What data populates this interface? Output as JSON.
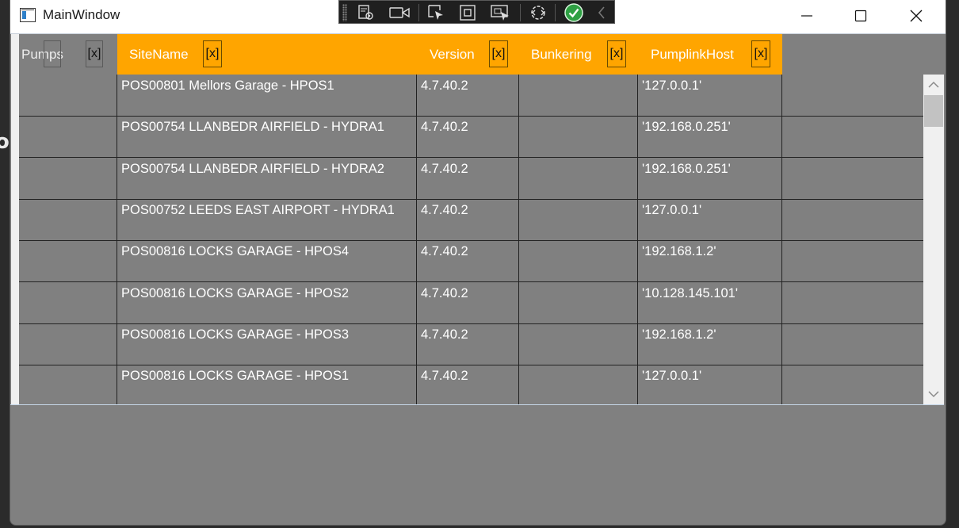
{
  "window": {
    "title": "MainWindow"
  },
  "columns": [
    {
      "label": "Pumps",
      "filter": "[x]"
    },
    {
      "label": "SiteName",
      "filter": "[x]"
    },
    {
      "label": "Version",
      "filter": "[x]"
    },
    {
      "label": "Bunkering",
      "filter": "[x]"
    },
    {
      "label": "PumplinkHost",
      "filter": "[x]"
    }
  ],
  "rows": [
    {
      "pumps": "",
      "site": "POS00801 Mellors Garage - HPOS1",
      "version": "4.7.40.2",
      "bunkering": "",
      "host": "'127.0.0.1'"
    },
    {
      "pumps": "",
      "site": "POS00754 LLANBEDR AIRFIELD  - HYDRA1",
      "version": "4.7.40.2",
      "bunkering": "",
      "host": "'192.168.0.251'"
    },
    {
      "pumps": "",
      "site": "POS00754 LLANBEDR AIRFIELD  - HYDRA2",
      "version": "4.7.40.2",
      "bunkering": "",
      "host": "'192.168.0.251'"
    },
    {
      "pumps": "",
      "site": "POS00752 LEEDS EAST AIRPORT  - HYDRA1",
      "version": "4.7.40.2",
      "bunkering": "",
      "host": "'127.0.0.1'"
    },
    {
      "pumps": "",
      "site": "POS00816 LOCKS GARAGE - HPOS4",
      "version": "4.7.40.2",
      "bunkering": "",
      "host": "'192.168.1.2'"
    },
    {
      "pumps": "",
      "site": "POS00816 LOCKS GARAGE - HPOS2",
      "version": "4.7.40.2",
      "bunkering": "",
      "host": "'10.128.145.101'"
    },
    {
      "pumps": "",
      "site": "POS00816 LOCKS GARAGE - HPOS3",
      "version": "4.7.40.2",
      "bunkering": "",
      "host": "'192.168.1.2'"
    },
    {
      "pumps": "",
      "site": "POS00816 LOCKS GARAGE - HPOS1",
      "version": "4.7.40.2",
      "bunkering": "",
      "host": "'127.0.0.1'"
    }
  ],
  "colors": {
    "header_accent": "#ffa500",
    "grid_background": "#808080",
    "cell_text": "#ffffff",
    "ok_badge": "#2ea043"
  },
  "icons": {
    "toolbar": [
      "live-visual-tree-icon",
      "record-icon",
      "select-element-icon",
      "display-layout-adorners-icon",
      "track-focused-element-icon",
      "hot-reload-icon",
      "binding-ok-icon",
      "collapse-toolbar-icon"
    ]
  }
}
